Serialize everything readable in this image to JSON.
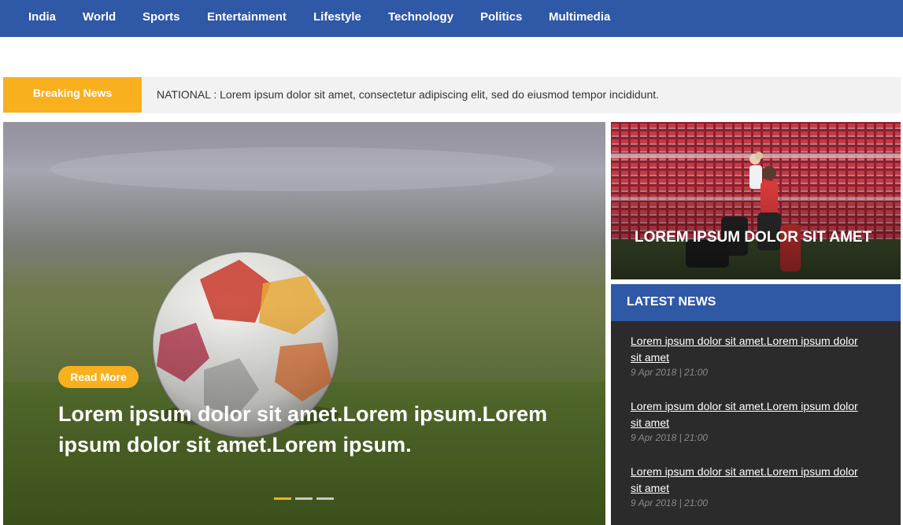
{
  "nav": {
    "items": [
      {
        "label": "India"
      },
      {
        "label": "World"
      },
      {
        "label": "Sports"
      },
      {
        "label": "Entertainment"
      },
      {
        "label": "Lifestyle"
      },
      {
        "label": "Technology"
      },
      {
        "label": "Politics"
      },
      {
        "label": "Multimedia"
      }
    ]
  },
  "breaking": {
    "label": "Breaking News",
    "text": "NATIONAL : Lorem ipsum dolor sit amet, consectetur adipiscing elit, sed do eiusmod tempor incididunt."
  },
  "hero": {
    "read_more": "Read More",
    "headline": "Lorem ipsum dolor sit amet.Lorem ipsum.Lorem ipsum dolor sit amet.Lorem ipsum.",
    "slides": 3,
    "active_slide": 1
  },
  "feature": {
    "title": "LOREM IPSUM DOLOR SIT AMET"
  },
  "latest": {
    "heading": "LATEST NEWS",
    "items": [
      {
        "title": "Lorem ipsum dolor sit amet.Lorem ipsum dolor sit amet",
        "date": "9 Apr 2018 | 21:00"
      },
      {
        "title": "Lorem ipsum dolor sit amet.Lorem ipsum dolor sit amet",
        "date": "9 Apr 2018 | 21:00"
      },
      {
        "title": "Lorem ipsum dolor sit amet.Lorem ipsum dolor sit amet",
        "date": "9 Apr 2018 | 21:00"
      }
    ]
  },
  "colors": {
    "nav_blue": "#2f58a6",
    "accent_orange": "#f8b01e",
    "latest_bg": "#2b2b2b"
  }
}
